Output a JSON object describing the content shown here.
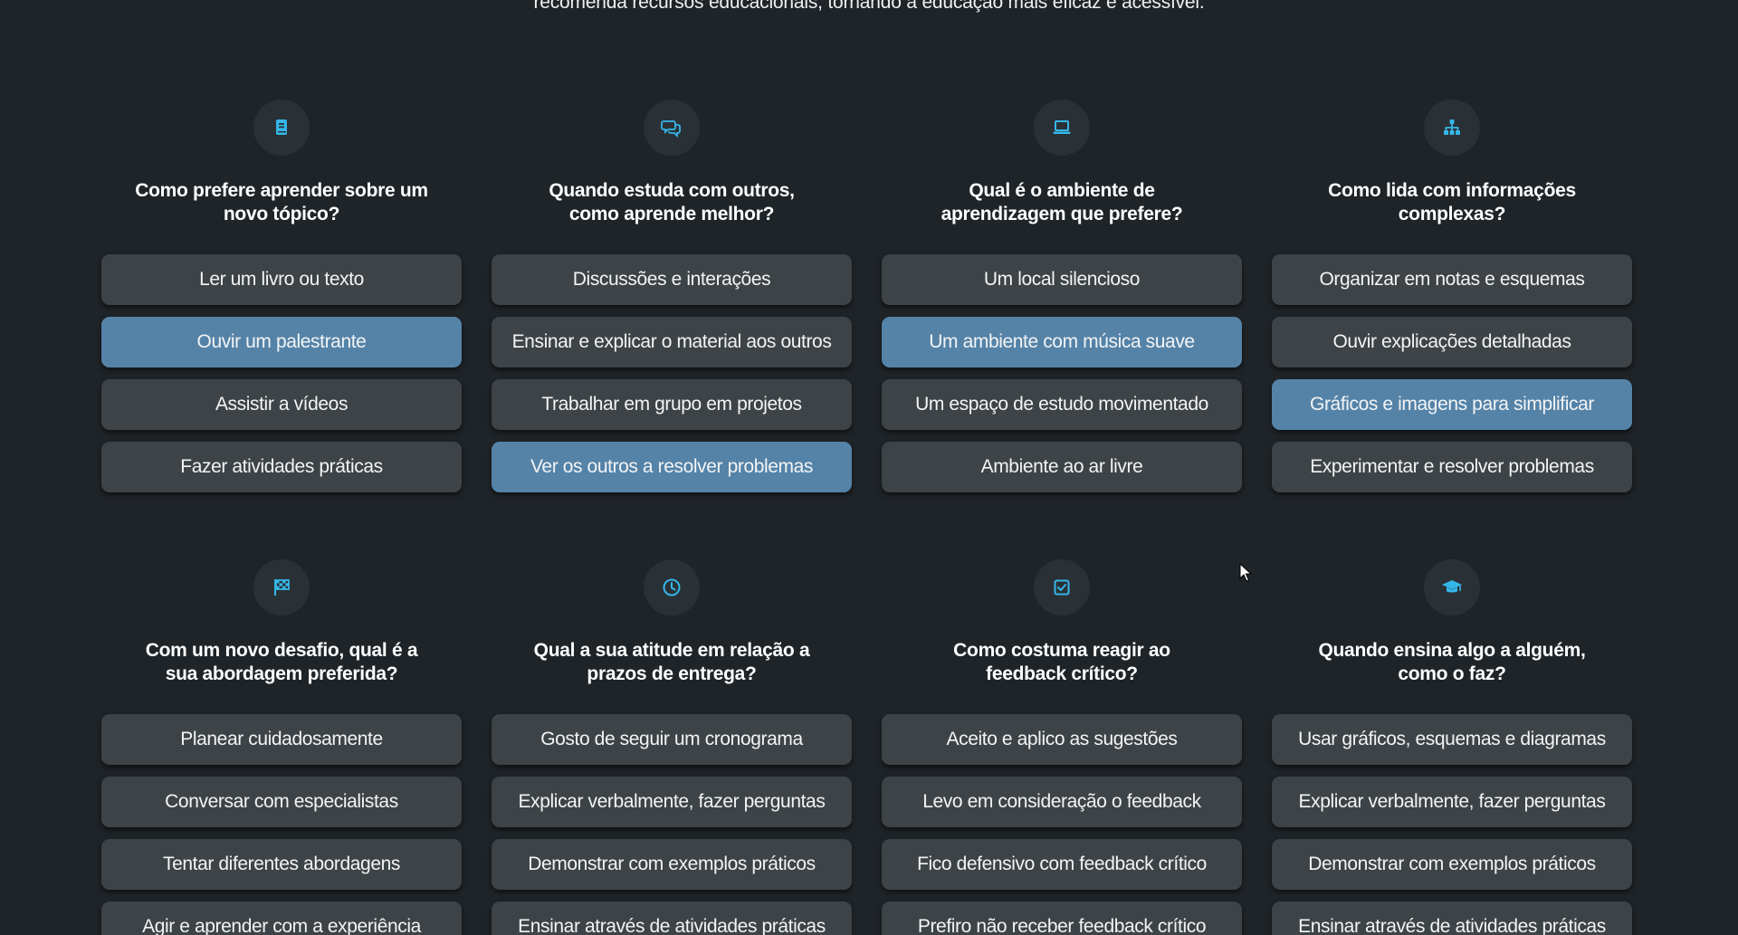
{
  "intro_text": "recomenda recursos educacionais, tornando a educação mais eficaz e acessível.",
  "colors": {
    "background": "#1f2428",
    "option_default": "#3d4346",
    "option_selected": "#5583a8",
    "icon_accent": "#35b6e8"
  },
  "questions": [
    {
      "icon": "book-icon",
      "title": "Como prefere aprender sobre um novo tópico?",
      "options": [
        "Ler um livro ou texto",
        "Ouvir um palestrante",
        "Assistir a vídeos",
        "Fazer atividades práticas"
      ],
      "selected_index": 1
    },
    {
      "icon": "chat-bubbles-icon",
      "title": "Quando estuda com outros, como aprende melhor?",
      "options": [
        "Discussões e interações",
        "Ensinar e explicar o material aos outros",
        "Trabalhar em grupo em projetos",
        "Ver os outros a resolver problemas"
      ],
      "selected_index": 3
    },
    {
      "icon": "laptop-icon",
      "title": "Qual é o ambiente de aprendizagem que prefere?",
      "options": [
        "Um local silencioso",
        "Um ambiente com música suave",
        "Um espaço de estudo movimentado",
        "Ambiente ao ar livre"
      ],
      "selected_index": 1
    },
    {
      "icon": "sitemap-icon",
      "title": "Como lida com informações complexas?",
      "options": [
        "Organizar em notas e esquemas",
        "Ouvir explicações detalhadas",
        "Gráficos e imagens para simplificar",
        "Experimentar e resolver problemas"
      ],
      "selected_index": 2
    },
    {
      "icon": "checkered-flag-icon",
      "title": "Com um novo desafio, qual é a sua abordagem preferida?",
      "options": [
        "Planear cuidadosamente",
        "Conversar com especialistas",
        "Tentar diferentes abordagens",
        "Agir e aprender com a experiência"
      ],
      "selected_index": -1
    },
    {
      "icon": "clock-icon",
      "title": "Qual a sua atitude em relação a prazos de entrega?",
      "options": [
        "Gosto de seguir um cronograma",
        "Explicar verbalmente, fazer perguntas",
        "Demonstrar com exemplos práticos",
        "Ensinar através de atividades práticas"
      ],
      "selected_index": -1
    },
    {
      "icon": "checkbox-icon",
      "title": "Como costuma reagir ao feedback crítico?",
      "options": [
        "Aceito e aplico as sugestões",
        "Levo em consideração o feedback",
        "Fico defensivo com feedback crítico",
        "Prefiro não receber feedback crítico"
      ],
      "selected_index": -1
    },
    {
      "icon": "graduation-cap-icon",
      "title": "Quando ensina algo a alguém, como o faz?",
      "options": [
        "Usar gráficos, esquemas e diagramas",
        "Explicar verbalmente, fazer perguntas",
        "Demonstrar com exemplos práticos",
        "Ensinar através de atividades práticas"
      ],
      "selected_index": -1
    }
  ]
}
